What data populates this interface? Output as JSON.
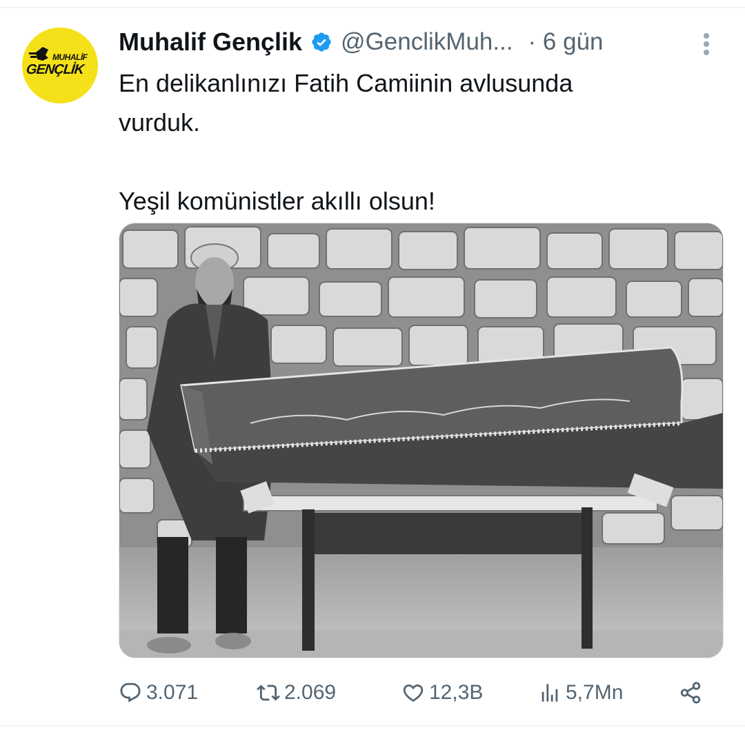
{
  "tweet": {
    "avatar": {
      "logo_line1": "MUHALİF",
      "logo_line2": "GENÇLİK",
      "background_color": "#f5e11a"
    },
    "author": {
      "display_name": "Muhalif Gençlik",
      "handle": "@GenclikMuh...",
      "verified": true,
      "verified_color": "#1d9bf0"
    },
    "timestamp": "· 6 gün",
    "more_icon": "more-vertical-icon",
    "text": {
      "line1": "En delikanlınızı Fatih Camiinin avlusunda",
      "line2": "vurduk.",
      "line3": "Yeşil komünistler akıllı olsun!"
    },
    "media": {
      "type": "photo",
      "icon": "photo"
    },
    "actions": {
      "replies": {
        "icon": "reply-icon",
        "count": "3.071"
      },
      "reposts": {
        "icon": "repost-icon",
        "count": "2.069"
      },
      "likes": {
        "icon": "heart-icon",
        "count": "12,3B"
      },
      "views": {
        "icon": "views-icon",
        "count": "5,7Mn"
      },
      "share": {
        "icon": "share-icon"
      }
    },
    "colors": {
      "text": "#0f1419",
      "secondary": "#536471",
      "accent": "#1d9bf0"
    }
  }
}
